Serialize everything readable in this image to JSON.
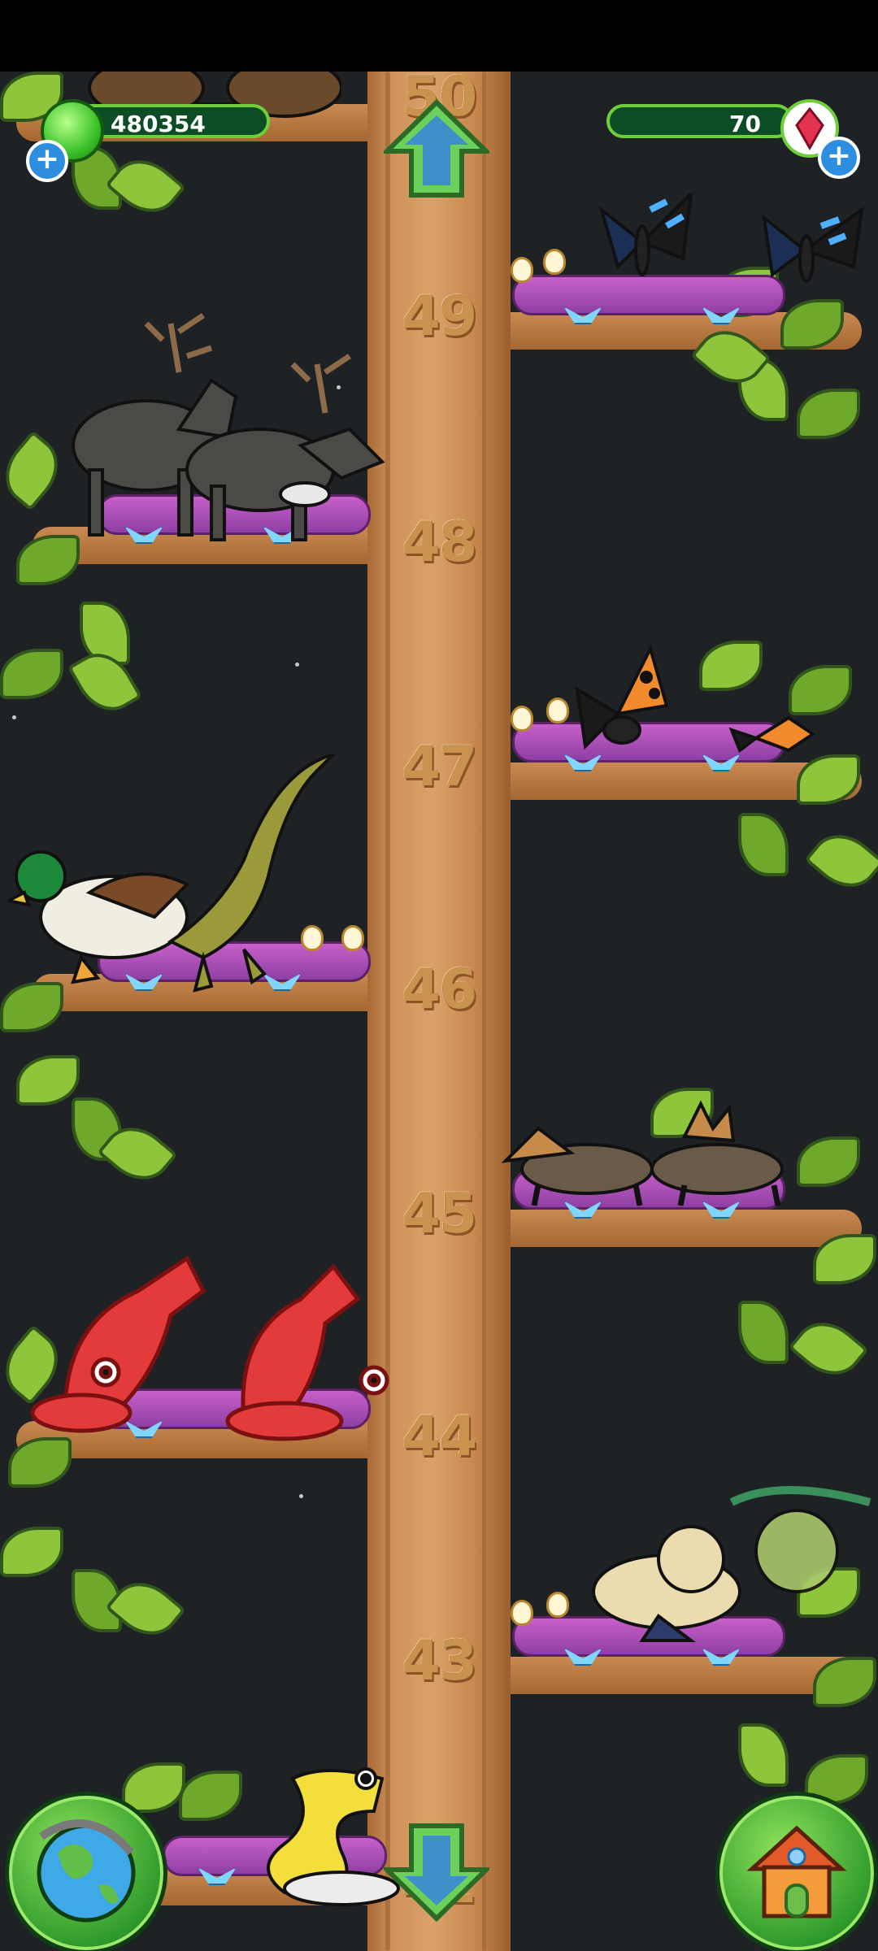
{
  "hud": {
    "dna_count": "480354",
    "gem_count": "70"
  },
  "levels": [
    "50",
    "49",
    "48",
    "47",
    "46",
    "45",
    "44",
    "43",
    "42"
  ],
  "buttons": {
    "up_icon": "up-arrow-icon",
    "down_icon": "down-arrow-icon",
    "globe_icon": "globe-icon",
    "home_icon": "house-icon"
  },
  "creatures": [
    {
      "level": "49",
      "name": "butterfly-pair"
    },
    {
      "level": "48",
      "name": "reindeer-pair"
    },
    {
      "level": "47",
      "name": "orange-butterfly-pair"
    },
    {
      "level": "46",
      "name": "duck-and-dinosaur"
    },
    {
      "level": "45",
      "name": "corgi-pair"
    },
    {
      "level": "44",
      "name": "lobster-pair"
    },
    {
      "level": "43",
      "name": "floppy-bunny-and-ghost"
    },
    {
      "level": "42",
      "name": "yellow-snake"
    }
  ],
  "colors": {
    "sky": "#1f2225",
    "trunk": "#cf9259",
    "leaf": "#8ec53a",
    "hud_green": "#6fcf3b",
    "plus_blue": "#2d8ee0"
  }
}
